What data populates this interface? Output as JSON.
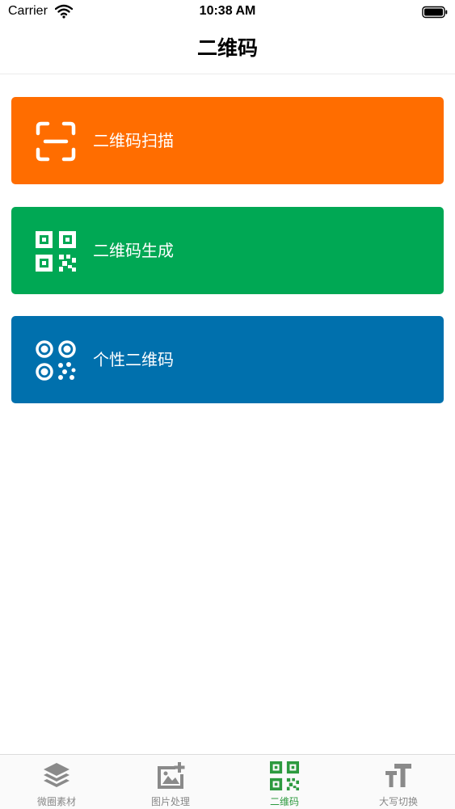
{
  "status_bar": {
    "carrier": "Carrier",
    "time": "10:38 AM"
  },
  "nav": {
    "title": "二维码"
  },
  "cards": [
    {
      "label": "二维码扫描",
      "color": "#ff6d00",
      "icon": "scan-frame-icon"
    },
    {
      "label": "二维码生成",
      "color": "#00a854",
      "icon": "qr-code-icon"
    },
    {
      "label": "个性二维码",
      "color": "#0070ad",
      "icon": "custom-qr-icon"
    }
  ],
  "tabs": [
    {
      "label": "微圈素材",
      "icon": "layers-icon",
      "active": false
    },
    {
      "label": "图片处理",
      "icon": "image-add-icon",
      "active": false
    },
    {
      "label": "二维码",
      "icon": "qr-code-icon",
      "active": true
    },
    {
      "label": "大写切换",
      "icon": "text-case-icon",
      "active": false
    }
  ],
  "colors": {
    "tab_active": "#2d9a3f",
    "tab_inactive": "#888888"
  }
}
